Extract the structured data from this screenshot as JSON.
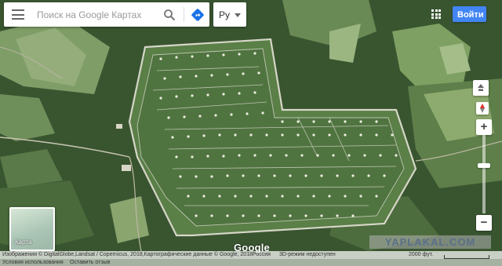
{
  "search": {
    "placeholder": "Поиск на Google Картах"
  },
  "language": {
    "label": "Ру"
  },
  "header": {
    "signin_label": "Войти"
  },
  "minimap": {
    "label": "Карта"
  },
  "logo": {
    "text": "Google"
  },
  "zoom": {
    "in_label": "+",
    "out_label": "−"
  },
  "footer": {
    "attribution": "Изображения © DigitalGlobe,Landsat / Copernicus, 2018,Картографические данные © Google, 2018",
    "region": "Россия",
    "notice": "3D-режим недоступен",
    "scale": "2000 фут.",
    "terms": "Условия использования",
    "feedback": "Оставить отзыв"
  },
  "watermark": {
    "text": "YAPLAKAL.COM"
  },
  "icons": {
    "menu": "hamburger-menu-icon",
    "search": "search-icon",
    "directions": "directions-icon",
    "apps": "apps-grid-icon",
    "tilt": "tilt-icon",
    "compass": "compass-icon"
  },
  "colors": {
    "accent": "#4285f4",
    "directions": "#1a73e8"
  }
}
